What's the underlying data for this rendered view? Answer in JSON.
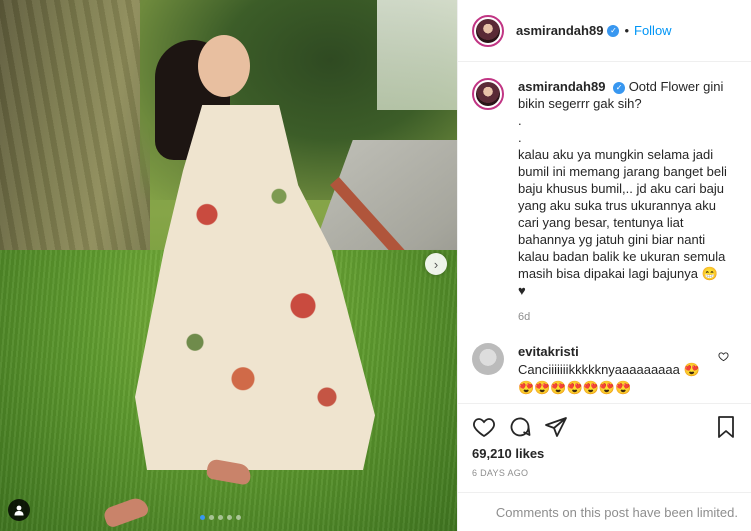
{
  "post": {
    "username": "asmirandah89",
    "verified_glyph": "✓",
    "separator": "•",
    "follow_label": "Follow",
    "caption": "Ootd Flower gini bikin segerrr gak sih?\n.\n.\nkalau aku ya mungkin selama jadi bumil ini memang jarang banget beli baju khusus bumil,.. jd aku cari baju yang aku suka trus ukurannya aku cari yang besar, tentunya liat bahannya yg jatuh gini biar nanti kalau badan balik ke ukuran semula masih bisa dipakai lagi bajunya 😁\n♥",
    "relative_time": "6d",
    "likes": "69,210 likes",
    "date": "6 DAYS AGO",
    "comments_limited": "Comments on this post have been limited."
  },
  "comments": [
    {
      "username": "evitakristi",
      "text": "Canciiiiiiikkkkknyaaaaaaaaa 😍\n😍😍😍😍😍😍😍"
    }
  ],
  "carousel": {
    "next_glyph": "›",
    "dot_count": 5,
    "active_dot": 0
  },
  "colors": {
    "accent": "#0095f6",
    "verified": "#3897f0",
    "muted": "#8e8e8e",
    "text": "#262626"
  },
  "icons": [
    "heart-icon",
    "comment-icon",
    "share-icon",
    "bookmark-icon",
    "user-tag-icon",
    "chevron-right-icon"
  ]
}
